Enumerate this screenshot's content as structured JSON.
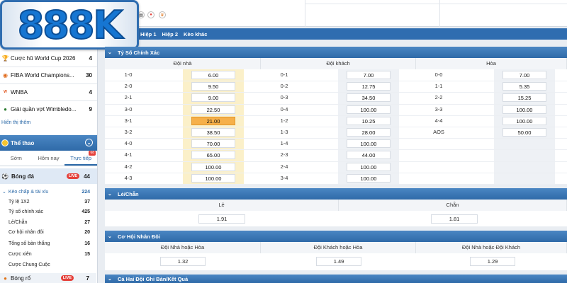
{
  "logo": {
    "text": "888K"
  },
  "sidebar": {
    "top_items": [
      {
        "icon": "trophy-icon",
        "label": "Cược hũ World Cup 2026",
        "count": "4"
      },
      {
        "icon": "fiba-icon",
        "label": "FIBA World Champions...",
        "count": "30"
      },
      {
        "icon": "wnba-icon",
        "label": "WNBA",
        "count": "4"
      },
      {
        "icon": "tennis-icon",
        "label": "Giải quần vợt Wimbledo...",
        "count": "9"
      }
    ],
    "show_more": "Hiển thị thêm",
    "sport_header": "Thể thao",
    "tabs": [
      {
        "label": "Sớm",
        "active": false
      },
      {
        "label": "Hôm nay",
        "active": false
      },
      {
        "label": "Trực tiếp",
        "active": true,
        "badge": "68"
      }
    ],
    "soccer": {
      "label": "Bóng đá",
      "live": "LIVE",
      "count": "44"
    },
    "sub_items": [
      {
        "label": "Kèo chấp & tài xỉu",
        "count": "224"
      },
      {
        "label": "Tỷ lệ 1X2",
        "count": "37"
      },
      {
        "label": "Tỷ số chính xác",
        "count": "425"
      },
      {
        "label": "Lẻ/Chẵn",
        "count": "27"
      },
      {
        "label": "Cơ hội nhân đôi",
        "count": "20"
      },
      {
        "label": "Tổng số bàn thắng",
        "count": "16"
      },
      {
        "label": "Cược xiên",
        "count": "15"
      },
      {
        "label": "Cược Chung Cuộc",
        "count": ""
      }
    ],
    "basketball": {
      "label": "Bóng rổ",
      "live": "LIVE",
      "count": "7"
    }
  },
  "period_tabs": [
    "Hiệp 1",
    "Hiệp 2",
    "Kèo khác"
  ],
  "correct_score": {
    "title": "Tỷ Số Chính Xác",
    "columns": [
      "Đội nhà",
      "Đội khách",
      "Hòa"
    ],
    "home": [
      {
        "score": "1-0",
        "odd": "6.00"
      },
      {
        "score": "2-0",
        "odd": "9.50"
      },
      {
        "score": "2-1",
        "odd": "9.00"
      },
      {
        "score": "3-0",
        "odd": "22.50"
      },
      {
        "score": "3-1",
        "odd": "21.00",
        "selected": true
      },
      {
        "score": "3-2",
        "odd": "38.50"
      },
      {
        "score": "4-0",
        "odd": "70.00"
      },
      {
        "score": "4-1",
        "odd": "65.00"
      },
      {
        "score": "4-2",
        "odd": "100.00"
      },
      {
        "score": "4-3",
        "odd": "100.00"
      }
    ],
    "away": [
      {
        "score": "0-1",
        "odd": "7.00"
      },
      {
        "score": "0-2",
        "odd": "12.75"
      },
      {
        "score": "0-3",
        "odd": "34.50"
      },
      {
        "score": "0-4",
        "odd": "100.00"
      },
      {
        "score": "1-2",
        "odd": "10.25"
      },
      {
        "score": "1-3",
        "odd": "28.00"
      },
      {
        "score": "1-4",
        "odd": "100.00"
      },
      {
        "score": "2-3",
        "odd": "44.00"
      },
      {
        "score": "2-4",
        "odd": "100.00"
      },
      {
        "score": "3-4",
        "odd": "100.00"
      }
    ],
    "draw": [
      {
        "score": "0-0",
        "odd": "7.00"
      },
      {
        "score": "1-1",
        "odd": "5.35"
      },
      {
        "score": "2-2",
        "odd": "15.25"
      },
      {
        "score": "3-3",
        "odd": "100.00"
      },
      {
        "score": "4-4",
        "odd": "100.00"
      },
      {
        "score": "AOS",
        "odd": "50.00"
      }
    ]
  },
  "odd_even": {
    "title": "Lẻ/Chẵn",
    "columns": [
      "Lẻ",
      "Chẵn"
    ],
    "odds": [
      "1.91",
      "1.81"
    ]
  },
  "double_chance": {
    "title": "Cơ Hội Nhân Đôi",
    "columns": [
      "Đội Nhà hoặc Hòa",
      "Đội Khách hoặc Hòa",
      "Đội Nhà hoặc Đội Khách"
    ],
    "odds": [
      "1.32",
      "1.49",
      "1.29"
    ]
  },
  "next_section": {
    "title": "Cả Hai Đội Ghi Bàn/Kết Quả"
  }
}
